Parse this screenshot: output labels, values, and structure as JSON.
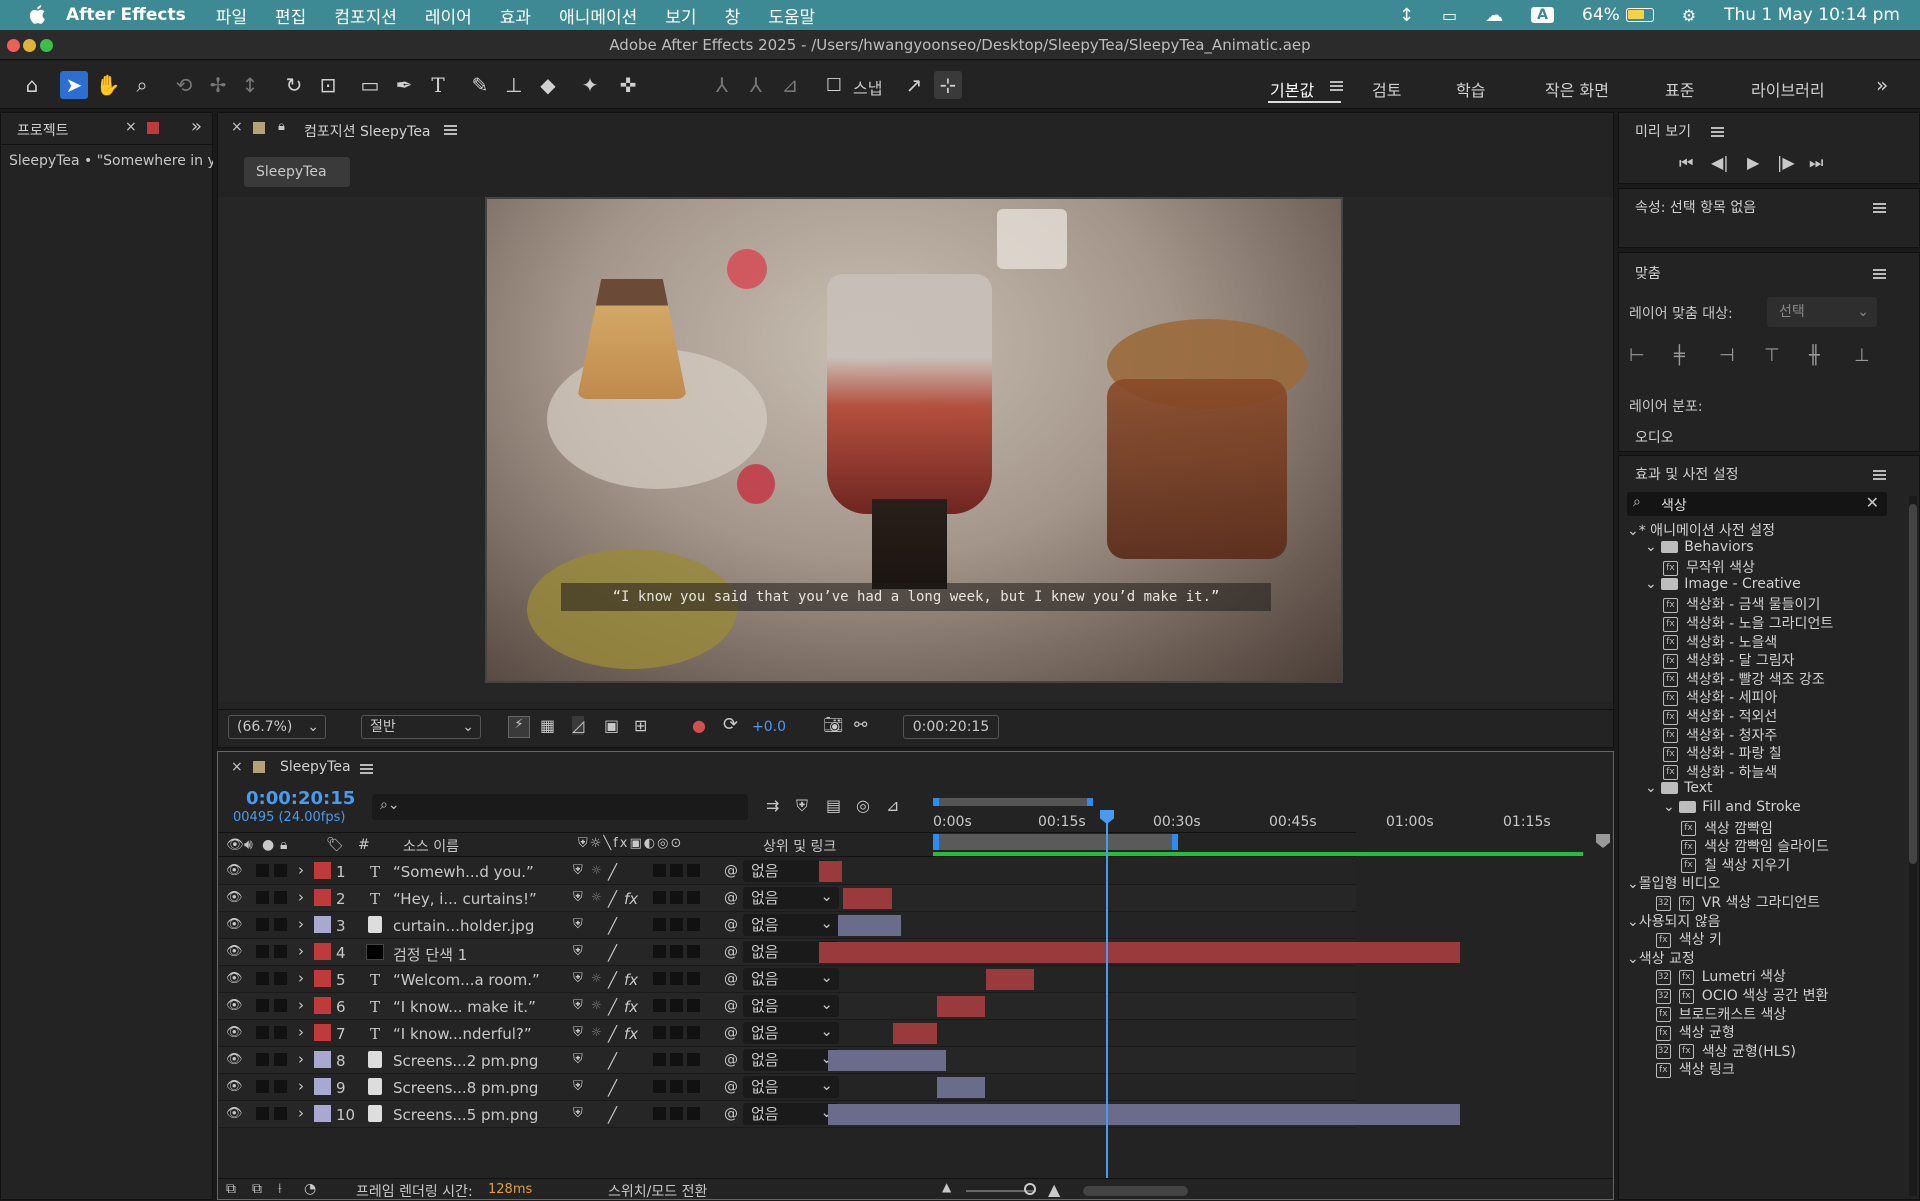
{
  "menubar": {
    "app_name": "After Effects",
    "items": [
      "파일",
      "편집",
      "컴포지션",
      "레이어",
      "효과",
      "애니메이션",
      "보기",
      "창",
      "도움말"
    ],
    "battery": "64%",
    "datetime": "Thu 1 May  10:14 pm"
  },
  "window": {
    "title": "Adobe After Effects 2025 - /Users/hwangyoonseo/Desktop/SleepyTea/SleepyTea_Animatic.aep"
  },
  "toolbar": {
    "snap_label": "스냅",
    "workspaces": [
      "기본값",
      "검토",
      "학습",
      "작은 화면",
      "표준",
      "라이브러리"
    ]
  },
  "project_panel": {
    "title": "프로젝트",
    "item": "SleepyTea • \"Somewhere in y"
  },
  "composition_panel": {
    "title": "컴포지션 SleepyTea",
    "tab": "SleepyTea",
    "subtitle": "“I know you said that you’ve had a long week, but I knew you’d make it.”",
    "zoom": "(66.7%)",
    "resolution": "절반",
    "exposure": "+0.0",
    "timecode": "0:00:20:15"
  },
  "timeline": {
    "title": "SleepyTea",
    "timecode": "0:00:20:15",
    "frame_info": "00495 (24.00fps)",
    "col_source": "소스 이름",
    "col_parent": "상위 및 링크",
    "ruler": [
      "0:00s",
      "00:15s",
      "00:30s",
      "00:45s",
      "01:00s",
      "01:15s"
    ],
    "render_label": "프레임 렌더링 시간:",
    "render_value": "128ms",
    "switch_label": "스위치/모드 전환",
    "layers": [
      {
        "num": "1",
        "type": "T",
        "name": "“Somewh...d you.”",
        "color": "#c0393b",
        "fx": false,
        "parent": "없음",
        "start": 0.014,
        "end": 0.05,
        "barcolor": "#9a3a3c"
      },
      {
        "num": "2",
        "type": "T",
        "name": "“Hey, i... curtains!”",
        "color": "#c0393b",
        "fx": true,
        "parent": "없음",
        "start": 0.05,
        "end": 0.126,
        "barcolor": "#9a3a3c"
      },
      {
        "num": "3",
        "type": "F",
        "name": "curtain...holder.jpg",
        "color": "#a8a8d0",
        "fx": false,
        "parent": "없음",
        "start": 0.043,
        "end": 0.14,
        "barcolor": "#6b6b8c"
      },
      {
        "num": "4",
        "type": "B",
        "name": "검정 단색 1",
        "color": "#c0393b",
        "fx": false,
        "parent": "없음",
        "start": 0.014,
        "end": 1.0,
        "barcolor": "#9a3a3c"
      },
      {
        "num": "5",
        "type": "T",
        "name": "“Welcom...a room.”",
        "color": "#c0393b",
        "fx": true,
        "parent": "없음",
        "start": 0.27,
        "end": 0.345,
        "barcolor": "#9a3a3c"
      },
      {
        "num": "6",
        "type": "T",
        "name": "“I know... make it.”",
        "color": "#c0393b",
        "fx": true,
        "parent": "없음",
        "start": 0.196,
        "end": 0.27,
        "barcolor": "#9a3a3c"
      },
      {
        "num": "7",
        "type": "T",
        "name": "“I know...nderful?”",
        "color": "#c0393b",
        "fx": true,
        "parent": "없음",
        "start": 0.127,
        "end": 0.196,
        "barcolor": "#9a3a3c"
      },
      {
        "num": "8",
        "type": "F",
        "name": "Screens...2 pm.png",
        "color": "#a8a8d0",
        "fx": false,
        "parent": "없음",
        "start": 0.027,
        "end": 0.209,
        "barcolor": "#6b6b8c"
      },
      {
        "num": "9",
        "type": "F",
        "name": "Screens...8 pm.png",
        "color": "#a8a8d0",
        "fx": false,
        "parent": "없음",
        "start": 0.196,
        "end": 0.27,
        "barcolor": "#6b6b8c"
      },
      {
        "num": "10",
        "type": "F",
        "name": "Screens...5 pm.png",
        "color": "#a8a8d0",
        "fx": false,
        "parent": "없음",
        "start": 0.027,
        "end": 1.0,
        "barcolor": "#6b6b8c"
      }
    ]
  },
  "right_panel": {
    "preview_title": "미리 보기",
    "properties_title": "속성: 선택 항목 없음",
    "align_title": "맞춤",
    "align_target_label": "레이어 맞춤 대상:",
    "align_target_value": "선택",
    "distribute_label": "레이어 분포:",
    "audio_label": "오디오",
    "effects_title": "효과 및 사전 설정",
    "search_value": "색상",
    "tree": [
      {
        "indent": 0,
        "kind": "arrow",
        "label": "* 애니메이션 사전 설정"
      },
      {
        "indent": 1,
        "kind": "folder",
        "label": "Behaviors"
      },
      {
        "indent": 2,
        "kind": "fx",
        "label": "무작위 색상"
      },
      {
        "indent": 1,
        "kind": "folder",
        "label": "Image - Creative"
      },
      {
        "indent": 2,
        "kind": "fx",
        "label": "색상화 - 금색 물들이기"
      },
      {
        "indent": 2,
        "kind": "fx",
        "label": "색상화 - 노을 그라디언트"
      },
      {
        "indent": 2,
        "kind": "fx",
        "label": "색상화 - 노을색"
      },
      {
        "indent": 2,
        "kind": "fx",
        "label": "색상화 - 달 그림자"
      },
      {
        "indent": 2,
        "kind": "fx",
        "label": "색상화 - 빨강 색조 강조"
      },
      {
        "indent": 2,
        "kind": "fx",
        "label": "색상화 - 세피아"
      },
      {
        "indent": 2,
        "kind": "fx",
        "label": "색상화 - 적외선"
      },
      {
        "indent": 2,
        "kind": "fx",
        "label": "색상화 - 청자주"
      },
      {
        "indent": 2,
        "kind": "fx",
        "label": "색상화 - 파랑 칠"
      },
      {
        "indent": 2,
        "kind": "fx",
        "label": "색상화 - 하늘색"
      },
      {
        "indent": 1,
        "kind": "folder",
        "label": "Text"
      },
      {
        "indent": 2,
        "kind": "folder",
        "label": "Fill and Stroke"
      },
      {
        "indent": 3,
        "kind": "fx",
        "label": "색상 깜빡임"
      },
      {
        "indent": 3,
        "kind": "fx",
        "label": "색상 깜빡임 슬라이드"
      },
      {
        "indent": 3,
        "kind": "fx",
        "label": "칠 색상 지우기"
      },
      {
        "indent": 0,
        "kind": "arrow",
        "label": "몰입형 비디오"
      },
      {
        "indent": 1.6,
        "kind": "fx2",
        "label": "VR 색상 그라디언트"
      },
      {
        "indent": 0,
        "kind": "arrow",
        "label": "사용되지 않음"
      },
      {
        "indent": 1.6,
        "kind": "fx1",
        "label": "색상 키"
      },
      {
        "indent": 0,
        "kind": "arrow",
        "label": "색상 교정"
      },
      {
        "indent": 1.6,
        "kind": "fx2",
        "label": "Lumetri 색상"
      },
      {
        "indent": 1.6,
        "kind": "fx2",
        "label": "OCIO 색상 공간 변환"
      },
      {
        "indent": 1.6,
        "kind": "fx1",
        "label": "브로드캐스트 색상"
      },
      {
        "indent": 1.6,
        "kind": "fx1",
        "label": "색상 균형"
      },
      {
        "indent": 1.6,
        "kind": "fx2",
        "label": "색상 균형(HLS)"
      },
      {
        "indent": 1.6,
        "kind": "fx1",
        "label": "색상 링크"
      }
    ]
  }
}
